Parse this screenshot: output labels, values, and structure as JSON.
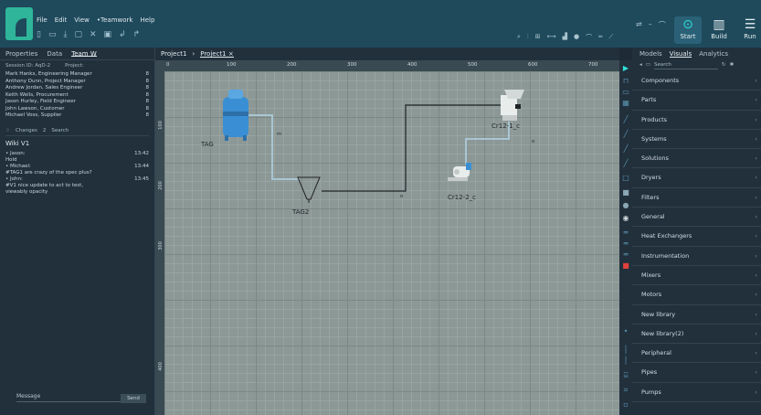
{
  "menu": [
    "File",
    "Edit",
    "View",
    "•Teamwork",
    "Help"
  ],
  "toolbar_icons": [
    "new-icon",
    "open-icon",
    "download-icon",
    "copy-icon",
    "close-icon",
    "chat-icon",
    "undo-icon",
    "redo-icon"
  ],
  "buttons": {
    "start": "Start",
    "build": "Build",
    "run": "Run"
  },
  "left_tabs": [
    "Properties",
    "Data",
    "Team W"
  ],
  "session": {
    "id": "Session ID: AqD-2",
    "project": "Project:"
  },
  "members": [
    {
      "name": "Mark Hanks, Engineering Manager",
      "n": "8"
    },
    {
      "name": "Anthony Dunn, Project Manager",
      "n": "8"
    },
    {
      "name": "Andrew Jordan, Sales Engineer",
      "n": "8"
    },
    {
      "name": "Keith Wells, Procurement",
      "n": "8"
    },
    {
      "name": "Jason Hurley, Field Engineer",
      "n": "8"
    },
    {
      "name": "John Lawson, Customer",
      "n": "8"
    },
    {
      "name": "Michael Voss, Supplier",
      "n": "8"
    }
  ],
  "filter": {
    "changes": "Changes",
    "count": "2",
    "search": "Search"
  },
  "wiki_title": "Wiki V1",
  "messages": [
    {
      "who": "• Jason:",
      "time": "13:42",
      "text": "Hold"
    },
    {
      "who": "• Michael:",
      "time": "13:44",
      "text": "#TAG1 are crazy of the spec plus?"
    },
    {
      "who": "• John:",
      "time": "13:45",
      "text": "#V1 nice update to act to test, viewably opacity"
    }
  ],
  "message_placeholder": "Message",
  "send_label": "Send",
  "project_tabs": [
    "Project1",
    "Project1 ×"
  ],
  "ruler_ticks": [
    "0",
    "100",
    "200",
    "300",
    "400",
    "500",
    "600",
    "700"
  ],
  "vruler_ticks": [
    "100",
    "200",
    "300",
    "400"
  ],
  "canvas": {
    "tag1": "TAG",
    "tag2": "TAG2",
    "c1": "Cr12-1_c",
    "c2": "Cr12-2_c",
    "port_a": "m",
    "port_b": "o",
    "port_c": "o"
  },
  "right_tabs": [
    "Models",
    "Visuals",
    "Analytics"
  ],
  "right_search": "Search",
  "categories": [
    "Components",
    "Parts",
    "Products",
    "Systems",
    "Solutions",
    "Dryers",
    "Filters",
    "General",
    "Heat Exchangers",
    "Instrumentation",
    "Mixers",
    "Motors",
    "New library",
    "New library(2)",
    "Peripheral",
    "Pipes",
    "Pumps"
  ],
  "colors": {
    "accent": "#2fb59a",
    "topbar": "#1f4a5c",
    "canvas": "#8c9896",
    "pipe_blue": "#a9c6d3"
  }
}
